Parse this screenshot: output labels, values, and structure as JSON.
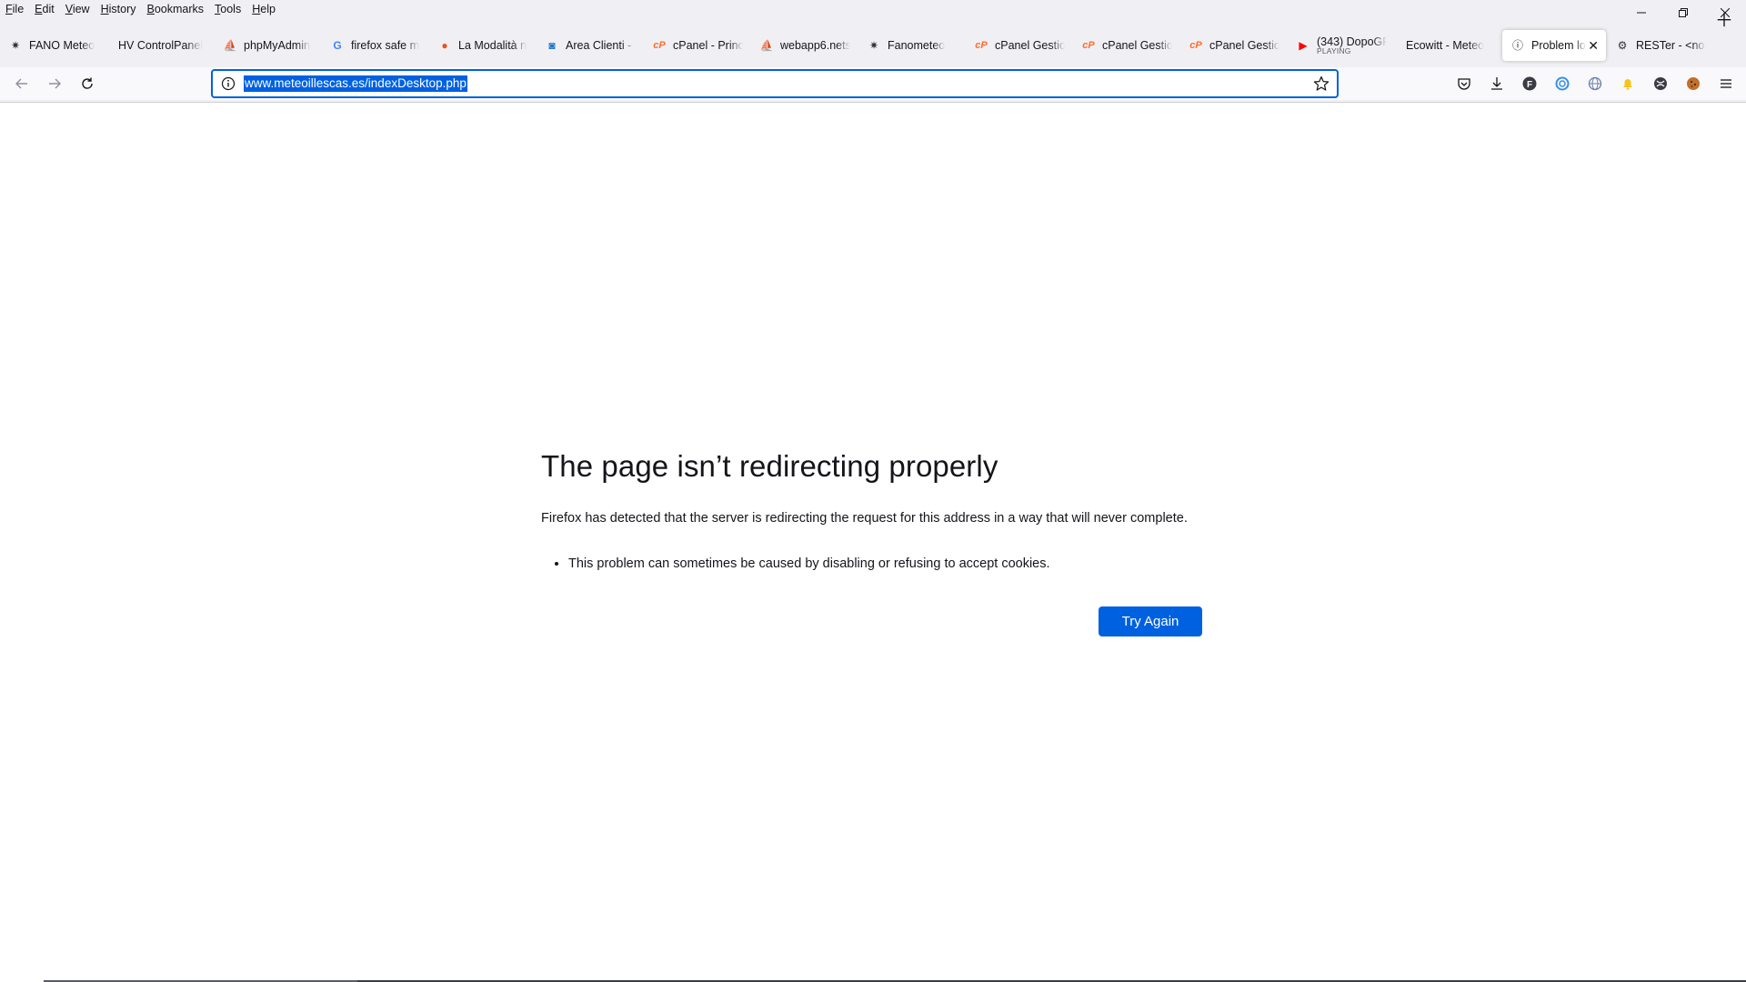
{
  "menu": [
    {
      "label": "File",
      "underline": "F",
      "rest": "ile"
    },
    {
      "label": "Edit",
      "underline": "E",
      "rest": "dit"
    },
    {
      "label": "View",
      "underline": "V",
      "rest": "iew"
    },
    {
      "label": "History",
      "underline": "H",
      "rest": "istory"
    },
    {
      "label": "Bookmarks",
      "underline": "B",
      "rest": "ookmarks"
    },
    {
      "label": "Tools",
      "underline": "T",
      "rest": "ools"
    },
    {
      "label": "Help",
      "underline": "H",
      "rest": "elp"
    }
  ],
  "tabs": [
    {
      "title": "FANO Meteo",
      "icon": "weather-station-icon",
      "glyph": "✷",
      "color": "#333333"
    },
    {
      "title": "HV ControlPanel",
      "icon": "",
      "glyph": "",
      "color": "#333333"
    },
    {
      "title": "phpMyAdmin",
      "icon": "phpmyadmin-icon",
      "glyph": "⛵",
      "color": "#c47a1a"
    },
    {
      "title": "firefox safe m",
      "icon": "google-icon",
      "glyph": "G",
      "color": "#4285f4"
    },
    {
      "title": "La Modalità n",
      "icon": "firefox-icon",
      "glyph": "●",
      "color": "#e8541c"
    },
    {
      "title": "Area Clienti - I",
      "icon": "area-clienti-icon",
      "glyph": "◙",
      "color": "#1a73c8"
    },
    {
      "title": "cPanel - Princ",
      "icon": "cpanel-icon",
      "glyph": "cP",
      "color": "#ff6c2c"
    },
    {
      "title": "webapp6.nets",
      "icon": "phpmyadmin-icon",
      "glyph": "⛵",
      "color": "#c47a1a"
    },
    {
      "title": "Fanometeo",
      "icon": "weather-station-icon",
      "glyph": "✷",
      "color": "#333333"
    },
    {
      "title": "cPanel Gestion",
      "icon": "cpanel-icon",
      "glyph": "cP",
      "color": "#ff6c2c"
    },
    {
      "title": "cPanel Gestion",
      "icon": "cpanel-icon",
      "glyph": "cP",
      "color": "#ff6c2c"
    },
    {
      "title": "cPanel Gestion",
      "icon": "cpanel-icon",
      "glyph": "cP",
      "color": "#ff6c2c"
    },
    {
      "title": "(343) DopoGP",
      "sub": "PLAYING",
      "icon": "youtube-icon",
      "glyph": "▶",
      "color": "#ff0000"
    },
    {
      "title": "Ecowitt - Meteo",
      "icon": "",
      "glyph": "",
      "color": "#333333"
    },
    {
      "title": "Problem lo",
      "icon": "info-icon",
      "glyph": "ⓘ",
      "color": "#15141a",
      "selected": true
    },
    {
      "title": "RESTer - <no c",
      "icon": "rester-icon",
      "glyph": "⚙",
      "color": "#333333"
    }
  ],
  "url": "www.meteoillescas.es/indexDesktop.php",
  "error": {
    "title": "The page isn’t redirecting properly",
    "description": "Firefox has detected that the server is redirecting the request for this address in a way that will never complete.",
    "bullets": [
      "This problem can sometimes be caused by disabling or refusing to accept cookies."
    ],
    "button": "Try Again"
  },
  "colors": {
    "accent": "#0061e0",
    "chrome": "#f0f0f4",
    "text": "#15141a"
  }
}
